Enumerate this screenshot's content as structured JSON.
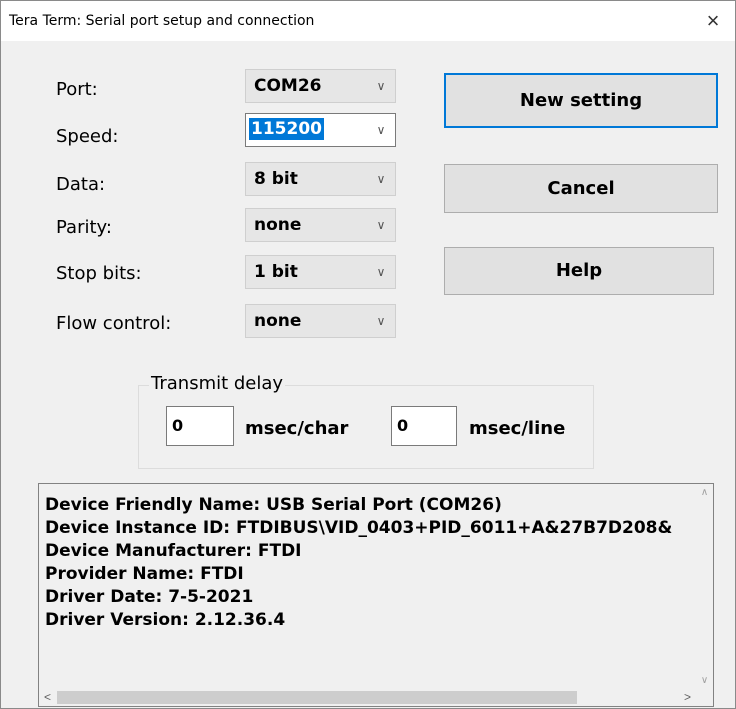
{
  "window": {
    "title": "Tera Term: Serial port setup and connection",
    "close_icon": "×"
  },
  "settings": [
    {
      "label": "Port:",
      "value": "COM26"
    },
    {
      "label": "Speed:",
      "value": "115200",
      "focused": true
    },
    {
      "label": "Data:",
      "value": "8 bit"
    },
    {
      "label": "Parity:",
      "value": "none"
    },
    {
      "label": "Stop bits:",
      "value": "1 bit"
    },
    {
      "label": "Flow control:",
      "value": "none"
    }
  ],
  "buttons": {
    "new_setting": "New setting",
    "cancel": "Cancel",
    "help": "Help"
  },
  "transmit_delay": {
    "title": "Transmit delay",
    "char_value": "0",
    "char_unit": "msec/char",
    "line_value": "0",
    "line_unit": "msec/line"
  },
  "device_info": [
    "Device Friendly Name: USB Serial Port (COM26)",
    "Device Instance ID: FTDIBUS\\VID_0403+PID_6011+A&27B7D208&",
    "Device Manufacturer: FTDI",
    "Provider Name: FTDI",
    "Driver Date: 7-5-2021",
    "Driver Version: 2.12.36.4"
  ],
  "icons": {
    "dropdown": "chevron-down-icon",
    "scroll_up": "scroll-up-icon",
    "scroll_down": "scroll-down-icon",
    "scroll_left": "scroll-left-icon",
    "scroll_right": "scroll-right-icon"
  },
  "colors": {
    "accent": "#0078d7",
    "dialog_bg": "#f0f0f0",
    "titlebar_bg": "#ffffff"
  }
}
